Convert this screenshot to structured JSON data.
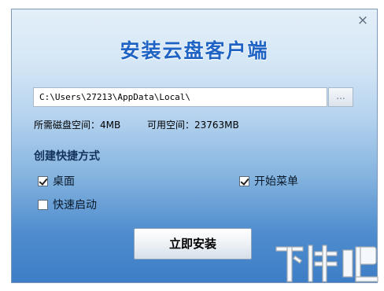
{
  "window": {
    "close_glyph": "×",
    "title": "安装云盘客户端"
  },
  "install_path": {
    "value": "C:\\Users\\27213\\AppData\\Local\\",
    "browse_label": "..."
  },
  "disk_info": {
    "required": "所需磁盘空间：4MB",
    "available": "可用空间：23763MB"
  },
  "shortcuts": {
    "heading": "创建快捷方式",
    "options": [
      {
        "label": "桌面",
        "checked": true
      },
      {
        "label": "开始菜单",
        "checked": true
      },
      {
        "label": "快速启动",
        "checked": false
      }
    ]
  },
  "install_button": "立即安装",
  "watermark": {
    "text": "下载吧"
  },
  "colors": {
    "title": "#1f63c4",
    "background_top": "#e3eff9",
    "background_bottom": "#3d7ec6"
  }
}
